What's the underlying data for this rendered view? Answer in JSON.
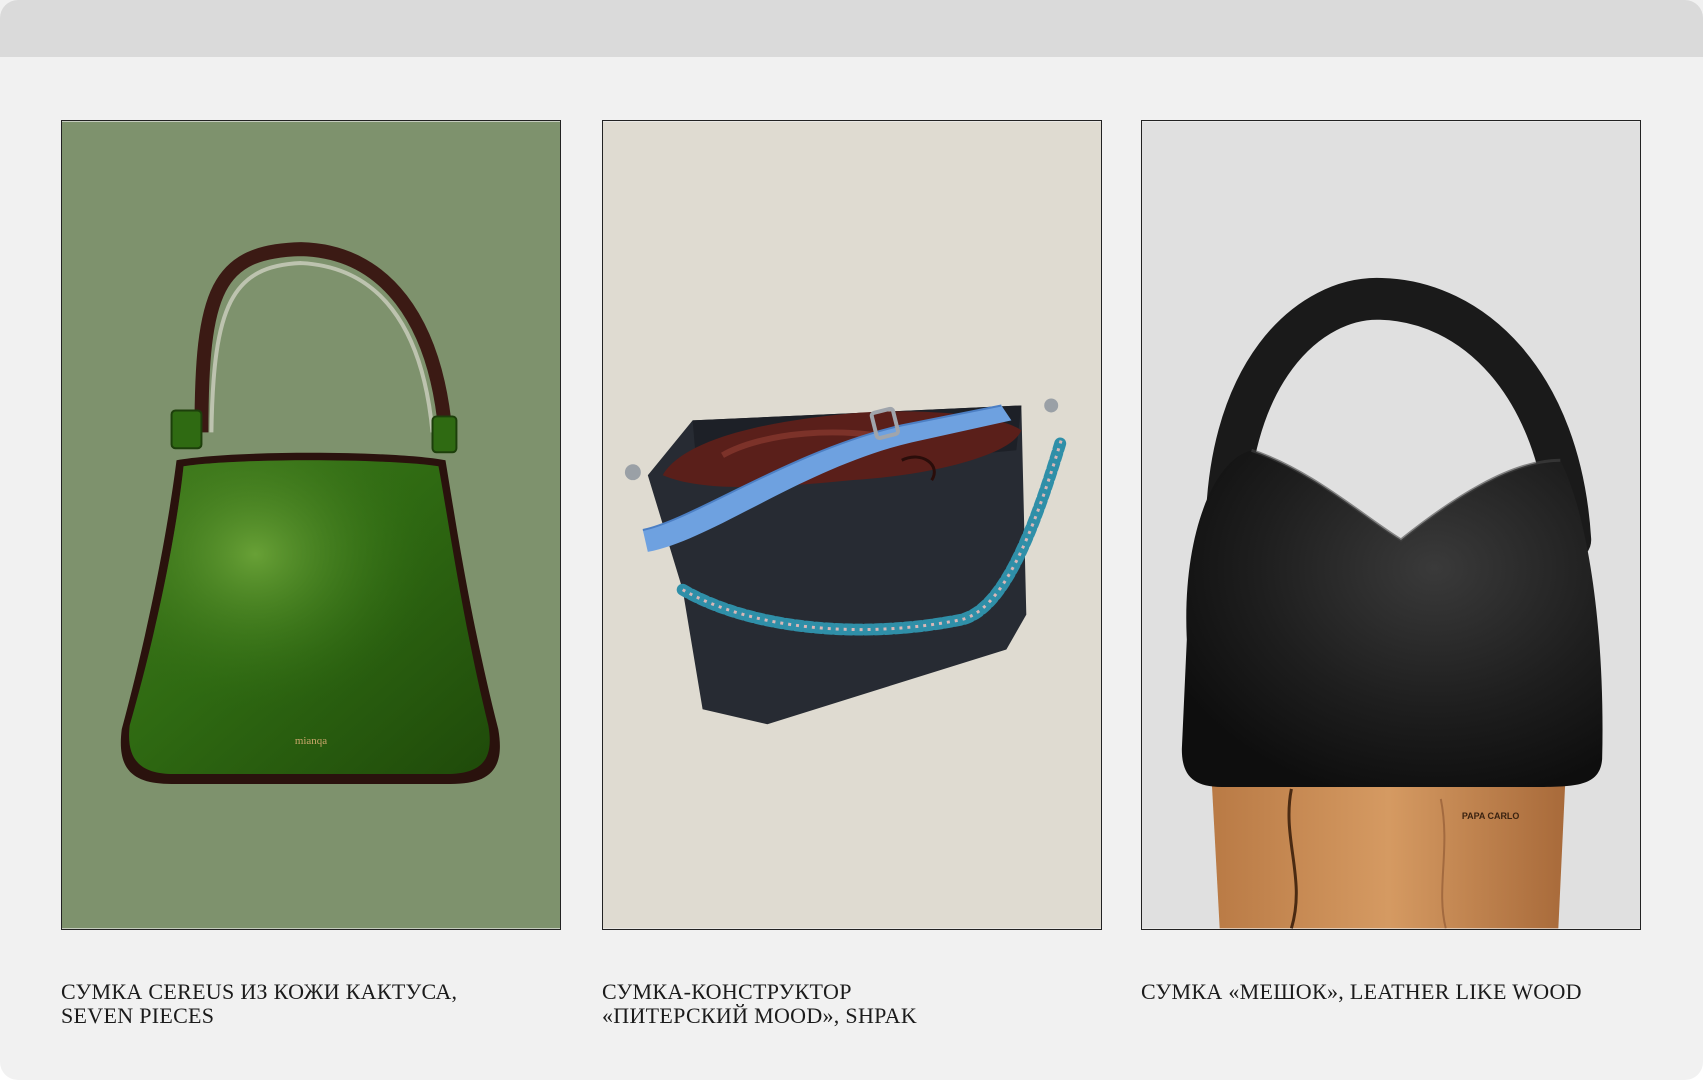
{
  "products": [
    {
      "line1": "СУМКА CEREUS ИЗ КОЖИ КАКТУСА,",
      "line2": "SEVEN PIECES",
      "bag_brand": "mianqa",
      "background": "#7e926d"
    },
    {
      "line1": "СУМКА-КОНСТРУКТОР",
      "line2": "«ПИТЕРСКИЙ MOOD», SHPAK",
      "background": "#dfdbd1"
    },
    {
      "line1": "СУМКА «МЕШОК», LEATHER LIKE WOOD",
      "line2": "",
      "stand_brand": "PAPA CARLO",
      "background": "#e0e0e0"
    }
  ],
  "colors": {
    "page": "#f1f1f1",
    "topbar": "#dadada",
    "caption": "#1b1b1b"
  }
}
